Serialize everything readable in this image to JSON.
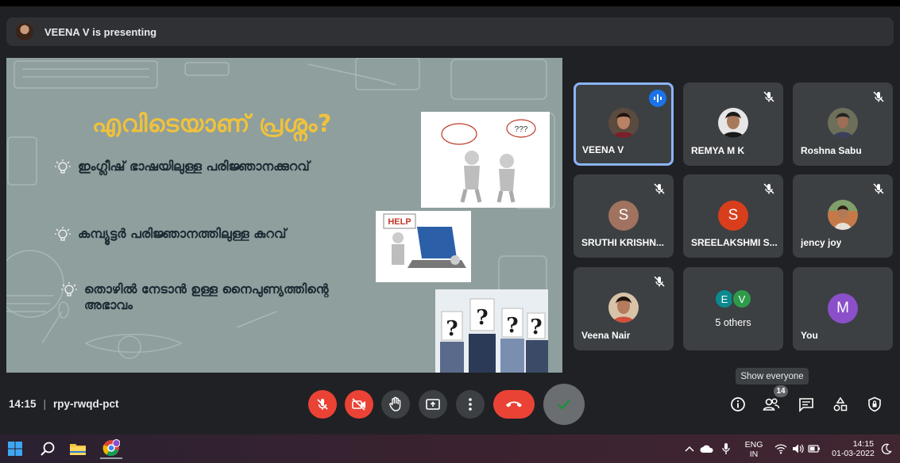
{
  "presenter": {
    "text": "VEENA V is presenting"
  },
  "slide": {
    "title": "എവിടെയാണ് പ്രശ്നം?",
    "bullets": [
      "ഇംഗ്ലീഷ് ഭാഷയിലുള്ള പരിജ്ഞാനക്കുറവ്",
      "കമ്പ്യൂട്ടർ പരിജ്ഞാനത്തിലുള്ള കുറവ്",
      "തൊഴിൽ നേടാൻ ഉള്ള നൈപുണ്യത്തിന്റെ",
      "അഭാവം"
    ],
    "images": {
      "bubble_text": "???",
      "help_text": "HELP"
    }
  },
  "participants": [
    {
      "name": "VEENA V",
      "type": "photo",
      "speaking": true
    },
    {
      "name": "REMYA M K",
      "type": "photo",
      "muted": true
    },
    {
      "name": "Roshna Sabu",
      "type": "photo",
      "muted": true
    },
    {
      "name": "SRUTHI KRISHN...",
      "type": "letter",
      "letter": "S",
      "color": "#a1725f",
      "muted": true
    },
    {
      "name": "SREELAKSHMI S...",
      "type": "letter",
      "letter": "S",
      "color": "#d93e1c",
      "muted": true
    },
    {
      "name": "jency joy",
      "type": "photo",
      "muted": true
    },
    {
      "name": "Veena Nair",
      "type": "photo",
      "muted": true
    },
    {
      "name": "5 others",
      "type": "group",
      "letters": [
        "E",
        "V"
      ],
      "colors": [
        "#0b8a8f",
        "#2e9b4a"
      ]
    },
    {
      "name": "You",
      "type": "letter",
      "letter": "M",
      "color": "#8b4fc9"
    }
  ],
  "tooltip": "Show everyone",
  "meeting": {
    "time": "14:15",
    "code": "rpy-rwqd-pct"
  },
  "people_count": "14",
  "colors": {
    "tile_bg": "#3c4043",
    "accent_blue": "#8ab4f8",
    "danger_red": "#ea4335",
    "title_yellow": "#f0c23b"
  },
  "controls": {
    "center": [
      "mic-off-icon",
      "camera-off-icon",
      "raise-hand-icon",
      "present-icon",
      "more-options-icon",
      "end-call-icon",
      "check-icon"
    ],
    "right": [
      "info-icon",
      "people-icon",
      "chat-icon",
      "activities-icon",
      "host-controls-icon"
    ]
  },
  "taskbar": {
    "apps": [
      "windows-start-icon",
      "search-icon",
      "file-explorer-icon",
      "chrome-icon"
    ],
    "lang_top": "ENG",
    "lang_bottom": "IN",
    "time": "14:15",
    "date": "01-03-2022"
  }
}
